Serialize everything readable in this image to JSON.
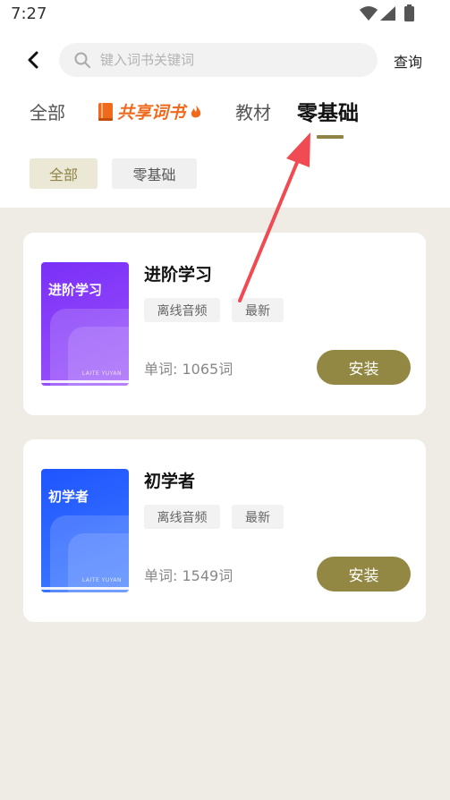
{
  "status_bar": {
    "time": "7:27",
    "icons": [
      "wifi-icon",
      "signal-icon",
      "battery-icon"
    ]
  },
  "header": {
    "back_icon": "chevron-left-icon",
    "search_placeholder": "键入词书关键词",
    "search_icon": "search-icon",
    "query_label": "查询"
  },
  "tabs": {
    "all": "全部",
    "share": "共享词书",
    "textbook": "教材",
    "active": "零基础"
  },
  "filters": {
    "all": "全部",
    "zero": "零基础"
  },
  "books": [
    {
      "title": "进阶学习",
      "cover_title": "进阶学习",
      "cover_brand": "LAITE YUYAN",
      "tags": [
        "离线音频",
        "最新"
      ],
      "words": "单词: 1065词",
      "action": "安装"
    },
    {
      "title": "初学者",
      "cover_title": "初学者",
      "cover_brand": "LAITE YUYAN",
      "tags": [
        "离线音频",
        "最新"
      ],
      "words": "单词: 1549词",
      "action": "安装"
    }
  ],
  "colors": {
    "accent": "#938843",
    "share_tab": "#f06a1e",
    "annotation_arrow": "#f04a52"
  }
}
